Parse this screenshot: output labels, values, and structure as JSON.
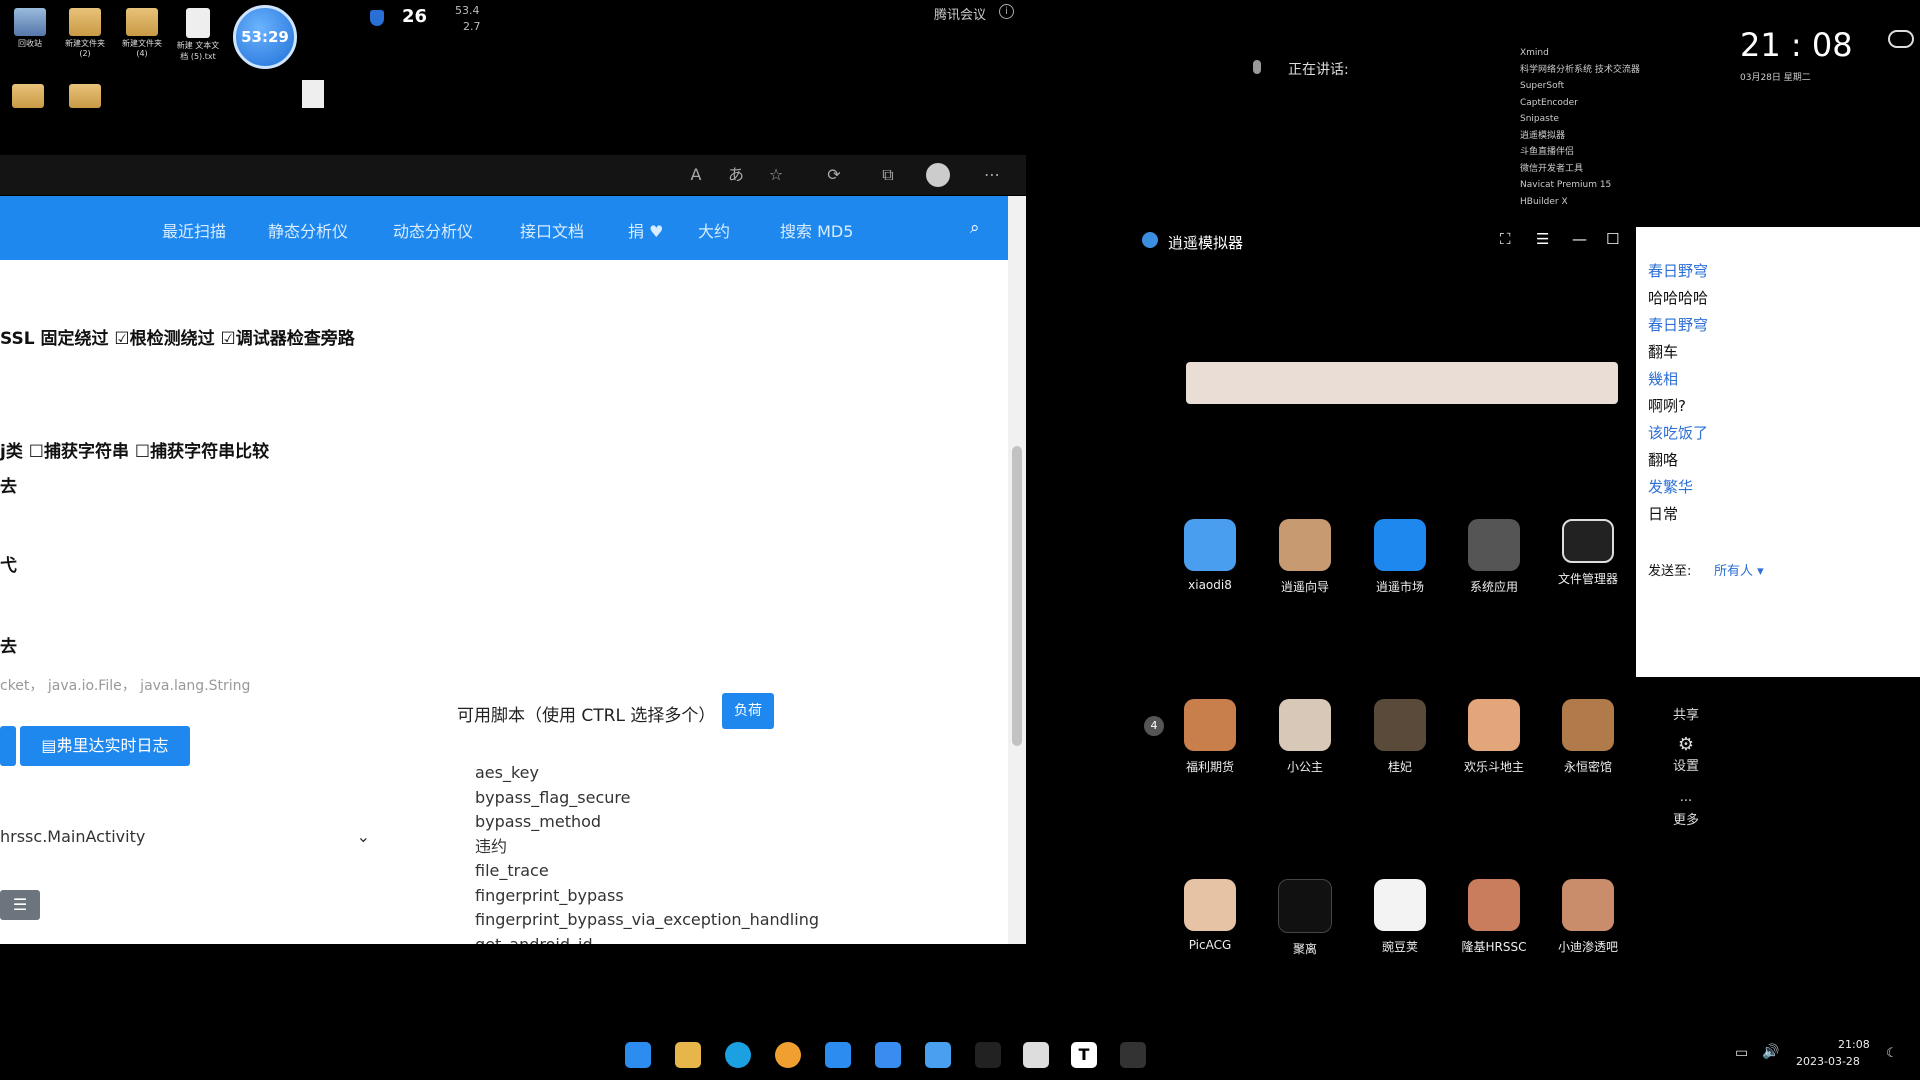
{
  "desktop": {
    "icons": [
      {
        "label": "回收站"
      },
      {
        "label": "新建文件夹 (2)"
      },
      {
        "label": "新建文件夹 (4)"
      },
      {
        "label": "新建 文本文档 (5).txt"
      }
    ],
    "timer_badge": "53:29",
    "weather_temp": "26",
    "net_up": "53.4",
    "net_down": "2.7",
    "meeting_app": "腾讯会议",
    "speaking_label": "正在讲话:"
  },
  "browser": {
    "nav_items": [
      "最近扫描",
      "静态分析仪",
      "动态分析仪",
      "接口文档",
      "捐 ♥",
      "大约",
      "搜索 MD5"
    ],
    "checks_line1": "SSL 固定绕过 ☑根检测绕过 ☑调试器检查旁路",
    "checks_line2": "j类 ☐捕获字符串 ☐捕获字符串比较",
    "frag_a": "去",
    "frag_b": "弋",
    "frag_c": "去",
    "classes_placeholder": "cket， java.io.File， java.lang.String",
    "log_button": "弗里达实时日志",
    "activity_select": "hrssc.MainActivity",
    "scripts_label": "可用脚本（使用 CTRL 选择多个）",
    "load_button": "负荷",
    "scripts": [
      "aes_key",
      "bypass_flag_secure",
      "bypass_method",
      "违约",
      "file_trace",
      "fingerprint_bypass",
      "fingerprint_bypass_via_exception_handling",
      "get_android_id"
    ]
  },
  "emulator": {
    "title": "逍遥模拟器",
    "apps_row1": [
      "xiaodi8",
      "逍遥向导",
      "逍遥市场",
      "系统应用",
      "文件管理器"
    ],
    "apps_row2": [
      "福利期货",
      "小公主",
      "桂妃",
      "欢乐斗地主",
      "永恒密馆"
    ],
    "apps_row3": [
      "PicACG",
      "聚离",
      "豌豆荚",
      "隆基HRSSC",
      "小迪渗透吧"
    ],
    "side_buttons": [
      "共享",
      "设置",
      "更多"
    ],
    "badge_4": "4"
  },
  "chat": {
    "lines": [
      {
        "text": "春日野穹",
        "is_name": true
      },
      {
        "text": "哈哈哈哈",
        "is_name": false
      },
      {
        "text": "春日野穹",
        "is_name": true
      },
      {
        "text": "翻车",
        "is_name": false
      },
      {
        "text": "幾相",
        "is_name": true
      },
      {
        "text": "啊咧?",
        "is_name": false
      },
      {
        "text": "该吃饭了",
        "is_name": true
      },
      {
        "text": "翻咯",
        "is_name": false
      },
      {
        "text": "发繁华",
        "is_name": true
      },
      {
        "text": "日常",
        "is_name": false
      }
    ],
    "send_to_label": "发送至:",
    "send_to_value": "所有人"
  },
  "tray_menu": [
    "Xmind",
    "科学网络分析系统 技术交流器",
    "SuperSoft",
    "CaptEncoder",
    "Snipaste",
    "逍遥模拟器",
    "斗鱼直播伴侣",
    "微信开发者工具",
    "Navicat Premium 15",
    "HBuilder X"
  ],
  "clock": {
    "time": "21 : 08",
    "date_small": "03月28日  星期二",
    "taskbar_time": "21:08",
    "taskbar_date": "2023-03-28"
  },
  "colors": {
    "accent": "#1e88ef",
    "chat_name": "#2d6fd6"
  }
}
